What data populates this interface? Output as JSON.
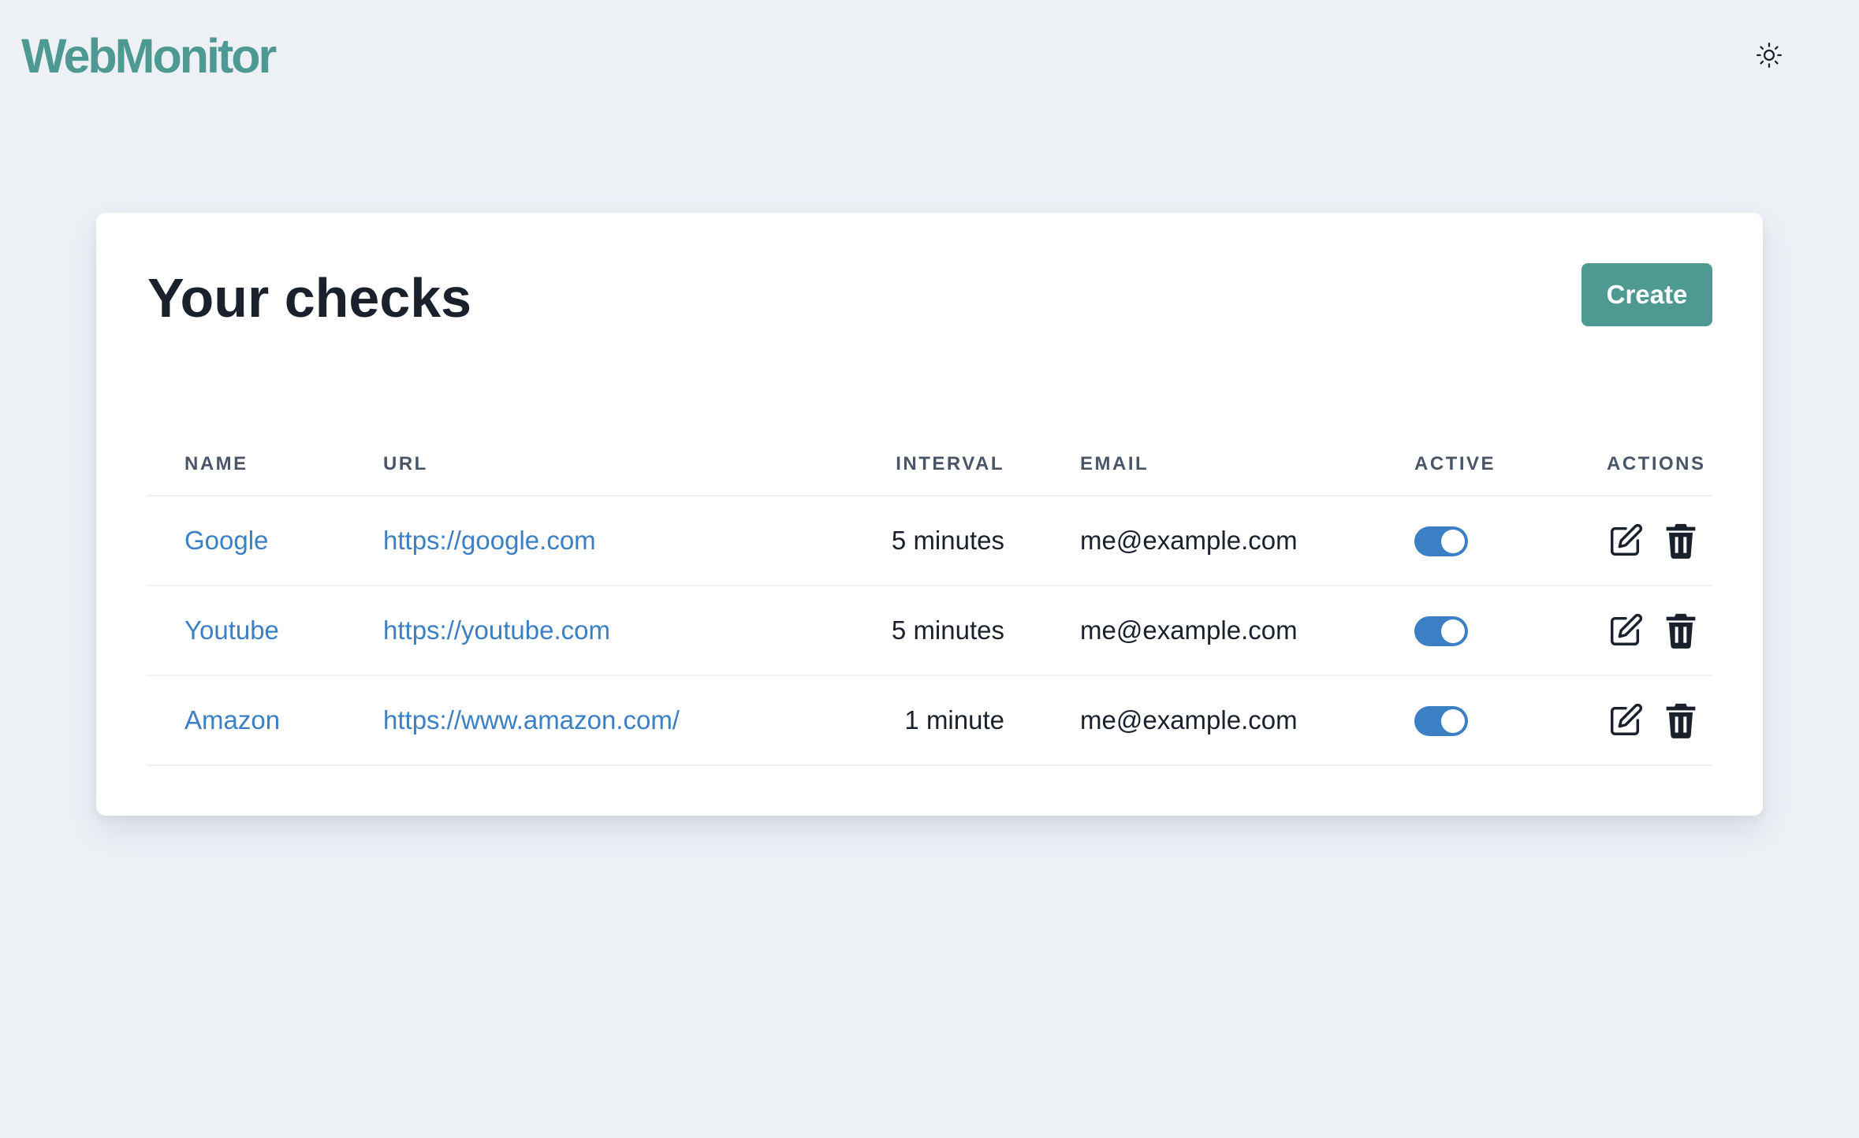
{
  "app": {
    "logo": "WebMonitor",
    "theme_icon": "sun-icon"
  },
  "page": {
    "title": "Your checks",
    "create_label": "Create"
  },
  "table": {
    "headers": {
      "name": "NAME",
      "url": "URL",
      "interval": "INTERVAL",
      "email": "EMAIL",
      "active": "ACTIVE",
      "actions": "ACTIONS"
    },
    "rows": [
      {
        "name": "Google",
        "url": "https://google.com",
        "interval": "5 minutes",
        "email": "me@example.com",
        "active": true
      },
      {
        "name": "Youtube",
        "url": "https://youtube.com",
        "interval": "5 minutes",
        "email": "me@example.com",
        "active": true
      },
      {
        "name": "Amazon",
        "url": "https://www.amazon.com/",
        "interval": "1 minute",
        "email": "me@example.com",
        "active": true
      }
    ],
    "row_action_icons": [
      "edit-icon",
      "trash-icon"
    ]
  },
  "colors": {
    "brand": "#4e9a93",
    "link": "#3b7fc4",
    "toggle_on": "#3b7fc4",
    "background": "#edf1f6"
  }
}
